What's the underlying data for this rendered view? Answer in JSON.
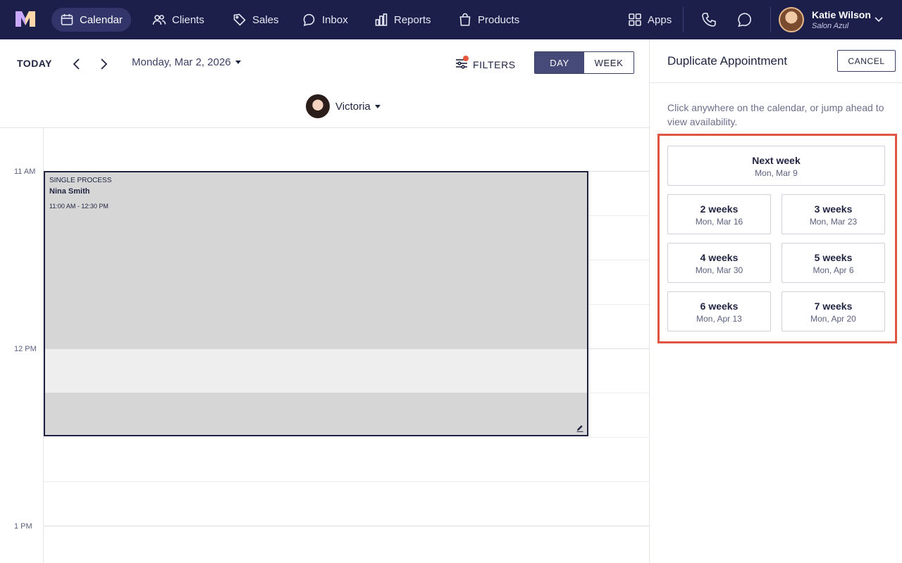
{
  "nav": {
    "items": [
      {
        "label": "Calendar",
        "icon": "calendar-icon",
        "active": true
      },
      {
        "label": "Clients",
        "icon": "users-icon",
        "active": false
      },
      {
        "label": "Sales",
        "icon": "tag-icon",
        "active": false
      },
      {
        "label": "Inbox",
        "icon": "chat-bubble-icon",
        "active": false
      },
      {
        "label": "Reports",
        "icon": "bar-chart-icon",
        "active": false
      },
      {
        "label": "Products",
        "icon": "shopping-bag-icon",
        "active": false
      }
    ],
    "apps_label": "Apps",
    "user": {
      "name": "Katie Wilson",
      "salon": "Salon Azul"
    }
  },
  "toolbar": {
    "today_label": "TODAY",
    "date_label": "Monday, Mar 2, 2026",
    "filters_label": "FILTERS",
    "view_day": "DAY",
    "view_week": "WEEK",
    "staff_name": "Victoria"
  },
  "calendar": {
    "times": [
      "11 AM",
      "12 PM",
      "1 PM"
    ],
    "appointment": {
      "type": "SINGLE PROCESS",
      "client": "Nina Smith",
      "time": "11:00 AM - 12:30 PM"
    }
  },
  "panel": {
    "title": "Duplicate Appointment",
    "cancel_label": "CANCEL",
    "description": "Click anywhere on the calendar, or jump ahead to view availability.",
    "options": [
      {
        "label": "Next week",
        "date": "Mon, Mar 9"
      },
      {
        "label": "2 weeks",
        "date": "Mon, Mar 16"
      },
      {
        "label": "3 weeks",
        "date": "Mon, Mar 23"
      },
      {
        "label": "4 weeks",
        "date": "Mon, Mar 30"
      },
      {
        "label": "5 weeks",
        "date": "Mon, Apr 6"
      },
      {
        "label": "6 weeks",
        "date": "Mon, Apr 13"
      },
      {
        "label": "7 weeks",
        "date": "Mon, Apr 20"
      }
    ]
  },
  "colors": {
    "nav_bg": "#1c1f4a",
    "accent": "#454a78",
    "highlight": "#e05441",
    "appointment": "#d6d6d6"
  }
}
